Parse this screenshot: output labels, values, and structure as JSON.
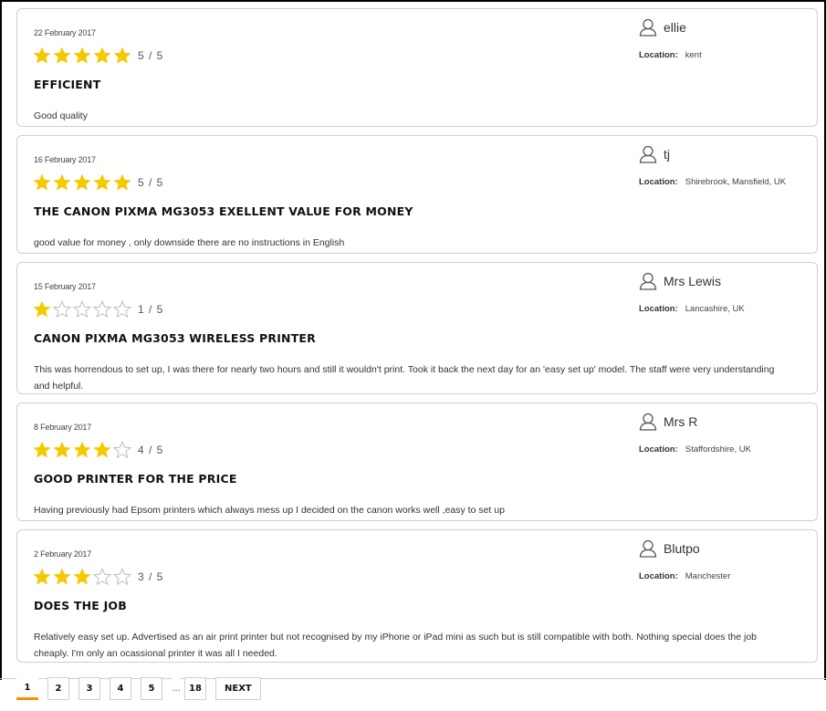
{
  "reviews": [
    {
      "date": "22 February 2017",
      "rating": 5,
      "score_text": "5 / 5",
      "title": "EFFICIENT",
      "body": "Good quality",
      "author": "ellie",
      "location_label": "Location:",
      "location": "kent"
    },
    {
      "date": "16 February 2017",
      "rating": 5,
      "score_text": "5 / 5",
      "title": "THE CANON PIXMA MG3053 EXELLENT VALUE FOR MONEY",
      "body": "good value for money , only downside there are no instructions in English",
      "author": "tj",
      "location_label": "Location:",
      "location": "Shirebrook, Mansfield, UK"
    },
    {
      "date": "15 February 2017",
      "rating": 1,
      "score_text": "1 / 5",
      "title": "CANON PIXMA MG3053 WIRELESS PRINTER",
      "body": "This was horrendous to set up, I was there for nearly two hours and still it wouldn't print. Took it back the next day for an 'easy set up' model.  The staff were very understanding and helpful.",
      "author": "Mrs Lewis",
      "location_label": "Location:",
      "location": "Lancashire, UK"
    },
    {
      "date": "8 February 2017",
      "rating": 4,
      "score_text": "4 / 5",
      "title": "GOOD PRINTER FOR THE PRICE",
      "body": "Having previously had Epsom printers which always mess up I decided on the canon works well ,easy to set up",
      "author": "Mrs R",
      "location_label": "Location:",
      "location": "Staffordshire, UK"
    },
    {
      "date": "2 February 2017",
      "rating": 3,
      "score_text": "3 / 5",
      "title": "DOES THE JOB",
      "body": "Relatively easy set up. Advertised as an air print printer but not recognised by my iPhone or iPad mini as such but is still compatible with both. Nothing special does the job cheaply. I'm only an ocassional printer it was all I needed.",
      "author": "Blutpo",
      "location_label": "Location:",
      "location": "Manchester"
    }
  ],
  "pagination": {
    "pages": [
      "1",
      "2",
      "3",
      "4",
      "5"
    ],
    "current": "1",
    "ellipsis": "...",
    "last": "18",
    "next_label": "NEXT"
  },
  "colors": {
    "star_filled": "#f5c900",
    "star_empty": "#bdbdbd",
    "accent": "#f39200"
  },
  "icons": {
    "star": "star-icon",
    "user": "user-icon"
  }
}
